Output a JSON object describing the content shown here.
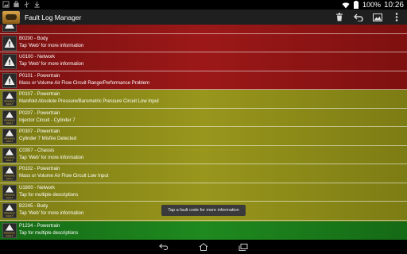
{
  "status_bar": {
    "battery": "100%",
    "time": "10:26"
  },
  "action_bar": {
    "title": "Fault Log Manager"
  },
  "colors": {
    "red_band": "#8b1212",
    "yellow_band": "#8c8c16",
    "green_band": "#1c7a1c"
  },
  "faults": [
    {
      "code_line": "B0200 - Body",
      "desc": "Tap 'Web' for more information",
      "status": "stored"
    },
    {
      "code_line": "U0100 - Network",
      "desc": "Tap 'Web' for more information",
      "status": "stored"
    },
    {
      "code_line": "P0101 - Powertrain",
      "desc": "Mass or Volume Air Flow Circuit Range/Performance Problem",
      "status": "stored"
    },
    {
      "code_line": "P0107 - Powertrain",
      "desc": "Manifold Absolute Pressure/Barometric Pressure Circuit Low Input",
      "status": "pending",
      "badge_text": "PENDING FAULT"
    },
    {
      "code_line": "P0207 - Powertrain",
      "desc": "Injector Circuit - Cylinder 7",
      "status": "pending",
      "badge_text": "PENDING FAULT"
    },
    {
      "code_line": "P0307 - Powertrain",
      "desc": "Cylinder 7 Misfire Detected",
      "status": "pending",
      "badge_text": "PENDING FAULT"
    },
    {
      "code_line": "C0307 - Chassis",
      "desc": "Tap 'Web' for more information",
      "status": "pending",
      "badge_text": "PENDING FAULT"
    },
    {
      "code_line": "P0102 - Powertrain",
      "desc": "Mass or Volume Air Flow Circuit Low Input",
      "status": "pending",
      "badge_text": "PENDING FAULT"
    },
    {
      "code_line": "U1600 - Network",
      "desc": "Tap for multiple descriptions",
      "status": "pending",
      "badge_text": "PENDING FAULT"
    },
    {
      "code_line": "B2245 - Body",
      "desc": "Tap 'Web' for more information",
      "status": "pending",
      "badge_text": "PENDING FAULT"
    },
    {
      "code_line": "P1234 - Powertrain",
      "desc": "Tap for multiple descriptions",
      "status": "pending",
      "badge_text": "PENDING FAULT"
    }
  ],
  "toast": "Tap a fault code for more information"
}
